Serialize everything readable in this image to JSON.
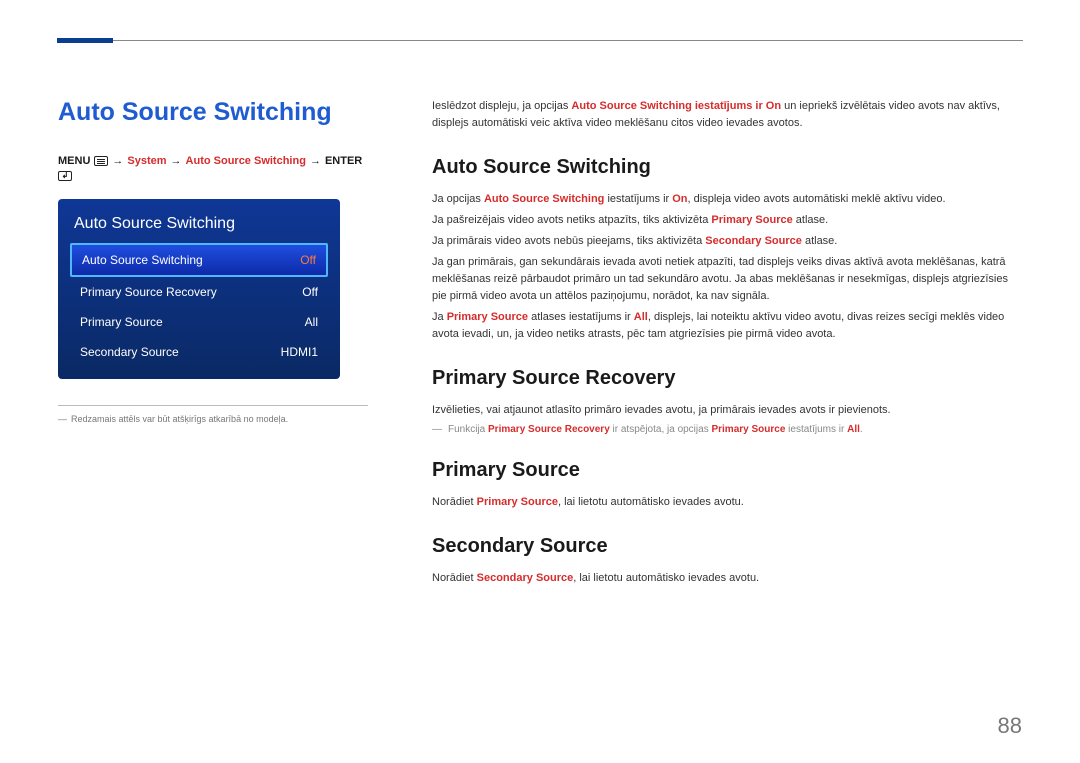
{
  "page_number": "88",
  "left": {
    "title": "Auto Source Switching",
    "menu_path": {
      "menu_label": "MENU",
      "arrow": "→",
      "system_label": "System",
      "feature_label": "Auto Source Switching",
      "enter_label": "ENTER"
    },
    "panel": {
      "header": "Auto Source Switching",
      "rows": [
        {
          "label": "Auto Source Switching",
          "value": "Off",
          "selected": true
        },
        {
          "label": "Primary Source Recovery",
          "value": "Off",
          "selected": false
        },
        {
          "label": "Primary Source",
          "value": "All",
          "selected": false
        },
        {
          "label": "Secondary Source",
          "value": "HDMI1",
          "selected": false
        }
      ]
    },
    "footnote": "Redzamais attēls var būt atšķirīgs atkarībā no modeļa."
  },
  "intro": {
    "p1_pre": "Ieslēdzot displeju, ja opcijas ",
    "p1_strong": "Auto Source Switching iestatījums ir On",
    "p1_post": " un iepriekš izvēlētais video avots nav aktīvs, displejs automātiski veic aktīva video meklēšanu citos video ievades avotos."
  },
  "section_ass": {
    "heading": "Auto Source Switching",
    "p1_a": "Ja opcijas ",
    "p1_s1": "Auto Source Switching",
    "p1_b": " iestatījums ir ",
    "p1_s2": "On",
    "p1_c": ", displeja video avots automātiski meklē aktīvu video.",
    "p2_a": "Ja pašreizējais video avots netiks atpazīts, tiks aktivizēta ",
    "p2_s1": "Primary Source",
    "p2_b": " atlase.",
    "p3_a": "Ja primārais video avots nebūs pieejams, tiks aktivizēta ",
    "p3_s1": "Secondary Source",
    "p3_b": " atlase.",
    "p4": "Ja gan primārais, gan sekundārais ievada avoti netiek atpazīti, tad displejs veiks divas aktīvā avota meklēšanas, katrā meklēšanas reizē pārbaudot primāro un tad sekundāro avotu. Ja abas meklēšanas ir nesekmīgas, displejs atgriezīsies pie pirmā video avota un attēlos paziņojumu, norādot, ka nav signāla.",
    "p5_a": "Ja ",
    "p5_s1": "Primary Source",
    "p5_b": " atlases iestatījums ir ",
    "p5_s2": "All",
    "p5_c": ", displejs, lai noteiktu aktīvu video avotu, divas reizes secīgi meklēs video avota ievadi, un, ja video netiks atrasts, pēc tam atgriezīsies pie pirmā video avota."
  },
  "section_psr": {
    "heading": "Primary Source Recovery",
    "p1": "Izvēlieties, vai atjaunot atlasīto primāro ievades avotu, ja primārais ievades avots ir pievienots.",
    "note_a": "Funkcija ",
    "note_s1": "Primary Source Recovery",
    "note_b": " ir atspējota, ja opcijas ",
    "note_s2": "Primary Source",
    "note_c": " iestatījums ir ",
    "note_s3": "All",
    "note_d": "."
  },
  "section_ps": {
    "heading": "Primary Source",
    "p1_a": "Norādiet ",
    "p1_s1": "Primary Source",
    "p1_b": ", lai lietotu automātisko ievades avotu."
  },
  "section_ss": {
    "heading": "Secondary Source",
    "p1_a": "Norādiet ",
    "p1_s1": "Secondary Source",
    "p1_b": ", lai lietotu automātisko ievades avotu."
  }
}
